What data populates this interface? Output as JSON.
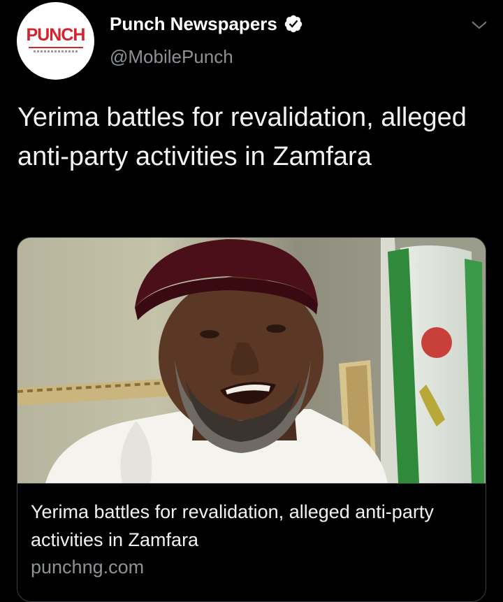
{
  "account": {
    "display_name": "Punch Newspapers",
    "handle": "@MobilePunch",
    "avatar_text": "PUNCH",
    "verified_icon": "verified-badge-icon"
  },
  "tweet": {
    "text": "Yerima battles for revalidation, alleged anti-party activities in Zamfara"
  },
  "card": {
    "title": "Yerima battles for revalidation, alleged anti-party activities in Zamfara",
    "domain": "punchng.com",
    "image_icon": "article-photo"
  },
  "menu": {
    "icon": "chevron-down-icon"
  },
  "colors": {
    "background": "#000000",
    "text_primary": "#ffffff",
    "text_secondary": "#8d9297",
    "card_border": "#3a3d41",
    "brand_red": "#d4232b"
  }
}
